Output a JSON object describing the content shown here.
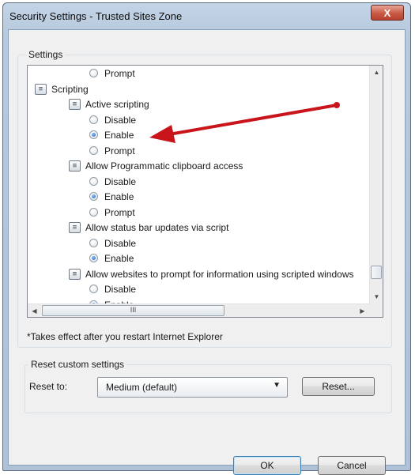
{
  "window": {
    "title": "Security Settings - Trusted Sites Zone",
    "close_glyph": "X"
  },
  "settings": {
    "label": "Settings",
    "tree": [
      {
        "type": "radio",
        "label": "Prompt",
        "checked": false,
        "indent": 2
      },
      {
        "type": "category",
        "label": "Scripting",
        "indent": 0
      },
      {
        "type": "category",
        "label": "Active scripting",
        "indent": 1
      },
      {
        "type": "radio",
        "label": "Disable",
        "checked": false,
        "indent": 2
      },
      {
        "type": "radio",
        "label": "Enable",
        "checked": true,
        "indent": 2
      },
      {
        "type": "radio",
        "label": "Prompt",
        "checked": false,
        "indent": 2
      },
      {
        "type": "category",
        "label": "Allow Programmatic clipboard access",
        "indent": 1
      },
      {
        "type": "radio",
        "label": "Disable",
        "checked": false,
        "indent": 2
      },
      {
        "type": "radio",
        "label": "Enable",
        "checked": true,
        "indent": 2
      },
      {
        "type": "radio",
        "label": "Prompt",
        "checked": false,
        "indent": 2
      },
      {
        "type": "category",
        "label": "Allow status bar updates via script",
        "indent": 1
      },
      {
        "type": "radio",
        "label": "Disable",
        "checked": false,
        "indent": 2
      },
      {
        "type": "radio",
        "label": "Enable",
        "checked": true,
        "indent": 2
      },
      {
        "type": "category",
        "label": "Allow websites to prompt for information using scripted windows",
        "indent": 1
      },
      {
        "type": "radio",
        "label": "Disable",
        "checked": false,
        "indent": 2
      },
      {
        "type": "radio",
        "label": "Enable",
        "checked": true,
        "indent": 2
      }
    ],
    "hscroll_thumb_glyph": "III",
    "restart_note": "*Takes effect after you restart Internet Explorer"
  },
  "reset": {
    "group_label": "Reset custom settings",
    "reset_to_label": "Reset to:",
    "selected_value": "Medium (default)",
    "reset_button": "Reset..."
  },
  "footer": {
    "ok_button": "OK",
    "cancel_button": "Cancel"
  },
  "colors": {
    "annotation_arrow": "#c9141b"
  }
}
